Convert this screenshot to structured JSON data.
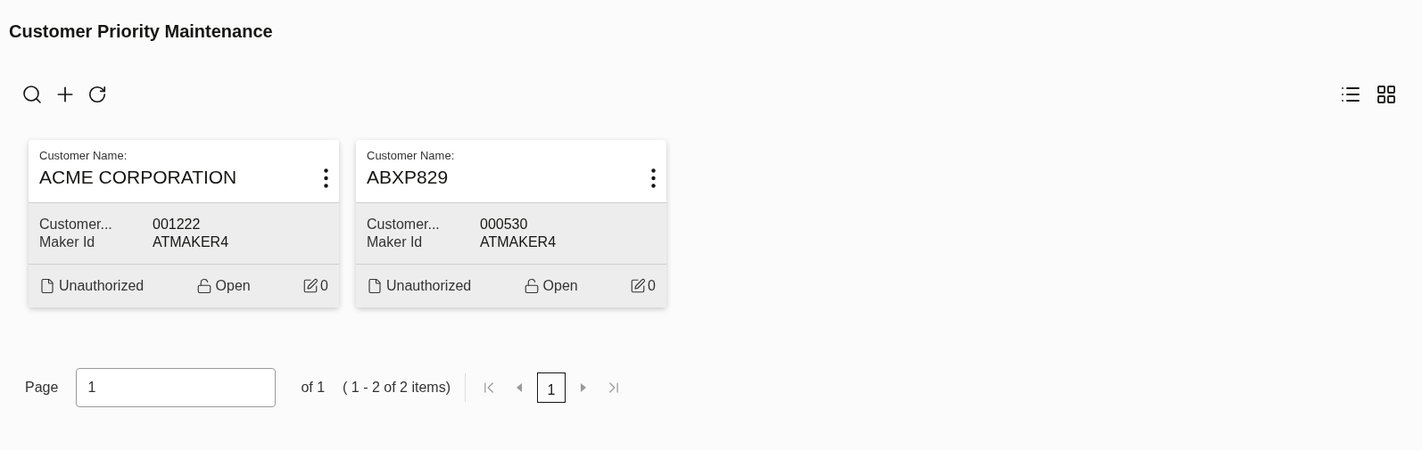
{
  "title": "Customer Priority Maintenance",
  "cards": [
    {
      "name_label": "Customer Name:",
      "name": "ACME CORPORATION",
      "fields": [
        {
          "label": "Customer...",
          "value": "001222"
        },
        {
          "label": "Maker Id",
          "value": "ATMAKER4"
        }
      ],
      "status": "Unauthorized",
      "record": "Open",
      "edits": "0"
    },
    {
      "name_label": "Customer Name:",
      "name": "ABXP829",
      "fields": [
        {
          "label": "Customer...",
          "value": "000530"
        },
        {
          "label": "Maker Id",
          "value": "ATMAKER4"
        }
      ],
      "status": "Unauthorized",
      "record": "Open",
      "edits": "0"
    }
  ],
  "pagination": {
    "page_label": "Page",
    "page_value": "1",
    "of": "of 1",
    "range": "( 1 - 2 of 2 items)",
    "pages": [
      {
        "label": "1",
        "selected": true
      }
    ]
  }
}
